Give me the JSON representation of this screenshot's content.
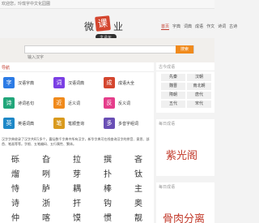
{
  "topbar": {
    "welcome_text": "欢迎您，玲珑字中文化园圃"
  },
  "logo": {
    "part1": "微",
    "part2": "课",
    "part3": "业",
    "tagline": "字词句"
  },
  "nav": {
    "items": [
      "首页",
      "字典",
      "词典",
      "成语",
      "作文",
      "诗词",
      "古诗"
    ],
    "active_index": 0
  },
  "search": {
    "placeholder": "输入汉字",
    "button_label": "搜索"
  },
  "tools": {
    "section_title": "导航",
    "items": [
      {
        "label": "汉语字典",
        "icon": "字",
        "color": "#2c7be5"
      },
      {
        "label": "汉语词典",
        "icon": "词",
        "color": "#7b3fe4"
      },
      {
        "label": "成语大全",
        "icon": "成",
        "color": "#d4462f"
      },
      {
        "label": "诗词名句",
        "icon": "诗",
        "color": "#21a67a"
      },
      {
        "label": "近义词",
        "icon": "近",
        "color": "#f08a1c"
      },
      {
        "label": "反义词",
        "icon": "反",
        "color": "#e53e8b"
      },
      {
        "label": "英语词典",
        "icon": "英",
        "color": "#1e88c7"
      },
      {
        "label": "笔顺查询",
        "icon": "笔",
        "color": "#d99a1e"
      },
      {
        "label": "多音字组词",
        "icon": "多",
        "color": "#6a4fb5"
      }
    ]
  },
  "intro_text": "汉字字典收录了汉字共8万多个，囊括数千字典中所有汉字，新华字典可在线查询汉字的拼音、意思、部首、笔画等等。字根、五笔编码、五行属性、繁体。",
  "characters": [
    [
      "砾",
      "旮",
      "拉",
      "撰",
      "吝"
    ],
    [
      "熘",
      "咧",
      "芽",
      "扑",
      "钛"
    ],
    [
      "恃",
      "胪",
      "耦",
      "棒",
      "主"
    ],
    [
      "诗",
      "浙",
      "扞",
      "钩",
      "奥"
    ],
    [
      "仲",
      "喀",
      "馍",
      "惯",
      "靓"
    ]
  ],
  "right": {
    "hot_title": "古今成语",
    "hot_tags": [
      "先秦",
      "汉朝",
      "魏晋",
      "南北朝",
      "隋朝",
      "唐代",
      "五代",
      "宋代",
      "元代",
      "明代"
    ],
    "daily_idiom_title": "每日成语",
    "daily_idiom": "紫光阁",
    "daily_idiom2_title": "每日成语",
    "daily_idiom2": "骨肉分离"
  }
}
